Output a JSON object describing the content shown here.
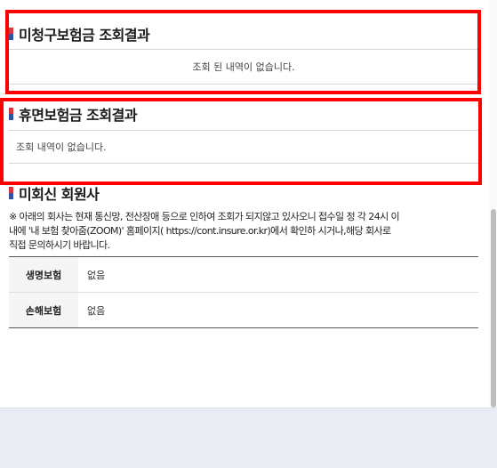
{
  "unclaimed": {
    "title": "미청구보험금 조회결과",
    "message": "조회 된 내역이 없습니다."
  },
  "dormant": {
    "title": "휴면보험금 조회결과",
    "message": "조회 내역이 없습니다."
  },
  "non_member": {
    "title": "미회신 회원사",
    "notice": "※ 아래의 회사는 현재 통신망, 전산장애 등으로 인하여 조회가 되지않고 있사오니 접수일 정 각 24시 이내에 '내 보험 찾아줌(ZOOM)' 홈페이지( https://cont.insure.or.kr)에서 확인하 시거나,해당 회사로 직접 문의하시기 바랍니다.",
    "rows": [
      {
        "label": "생명보험",
        "value": "없음"
      },
      {
        "label": "손해보험",
        "value": "없음"
      }
    ]
  },
  "colors": {
    "highlight": "#ff0000",
    "footer": "#e9edf3"
  }
}
